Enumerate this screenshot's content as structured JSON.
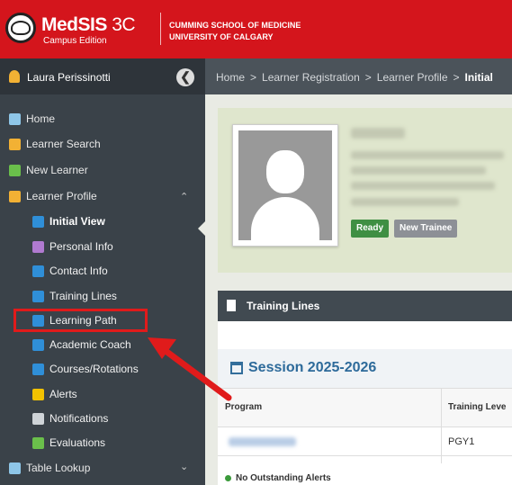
{
  "header": {
    "brand_name": "MedSIS",
    "brand_version": " 3C",
    "brand_sub": "Campus Edition",
    "school_line1": "CUMMING SCHOOL OF MEDICINE",
    "school_line2": "UNIVERSITY OF CALGARY"
  },
  "user": {
    "name": "Laura Perissinotti"
  },
  "breadcrumb": {
    "items": [
      "Home",
      "Learner Registration",
      "Learner Profile"
    ],
    "current": "Initial"
  },
  "sidebar": {
    "items": [
      {
        "label": "Home",
        "icon": "home-icon",
        "color": "#8ec6e8"
      },
      {
        "label": "Learner Search",
        "icon": "learner-search-icon",
        "color": "#f2b134"
      },
      {
        "label": "New Learner",
        "icon": "new-learner-icon",
        "color": "#6abf4b"
      },
      {
        "label": "Learner Profile",
        "icon": "learner-profile-icon",
        "color": "#f2b134"
      },
      {
        "label": "Initial View",
        "icon": "initial-view-icon",
        "color": "#2f8fd8"
      },
      {
        "label": "Personal Info",
        "icon": "personal-info-icon",
        "color": "#b07ad0"
      },
      {
        "label": "Contact Info",
        "icon": "contact-info-icon",
        "color": "#2f8fd8"
      },
      {
        "label": "Training Lines",
        "icon": "training-lines-icon",
        "color": "#2f8fd8"
      },
      {
        "label": "Learning Path",
        "icon": "learning-path-icon",
        "color": "#2f8fd8"
      },
      {
        "label": "Academic Coach",
        "icon": "academic-coach-icon",
        "color": "#2f8fd8"
      },
      {
        "label": "Courses/Rotations",
        "icon": "courses-icon",
        "color": "#2f8fd8"
      },
      {
        "label": "Alerts",
        "icon": "alert-icon",
        "color": "#f2c200"
      },
      {
        "label": "Notifications",
        "icon": "notifications-icon",
        "color": "#cfd4d8"
      },
      {
        "label": "Evaluations",
        "icon": "evaluations-icon",
        "color": "#6abf4b"
      },
      {
        "label": "Table Lookup",
        "icon": "table-lookup-icon",
        "color": "#8ec6e8"
      }
    ]
  },
  "profile": {
    "badge_ready": "Ready",
    "badge_new": "New Trainee"
  },
  "training": {
    "title": "Training Lines",
    "session": "Session 2025-2026",
    "col_program": "Program",
    "col_level": "Training Leve",
    "row_level": "PGY1",
    "alerts": "No Outstanding Alerts"
  },
  "colors": {
    "header_red": "#d4151c",
    "highlight_red": "#e01b1b",
    "ready_green": "#3f8f43",
    "new_trainee_gray": "#8d9096"
  }
}
